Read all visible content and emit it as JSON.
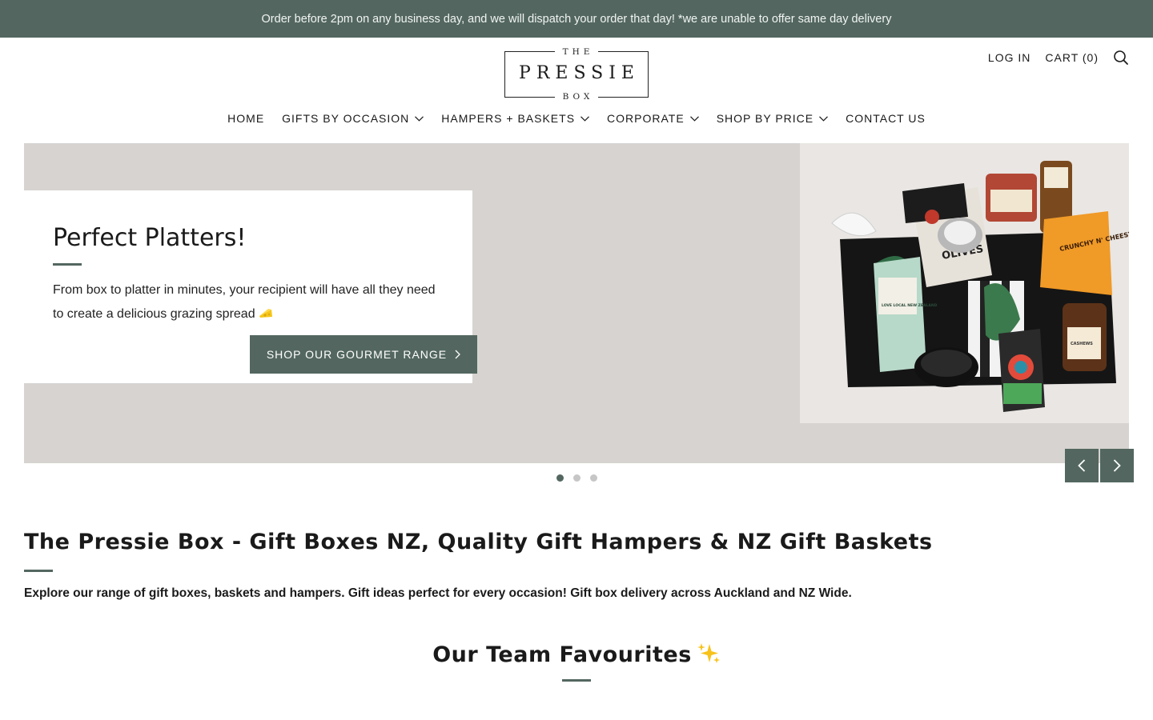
{
  "announcement": "Order before 2pm on any business day, and we will dispatch your order that day! *we are unable to offer same day delivery",
  "logo": {
    "top": "THE",
    "main": "PRESSIE",
    "bottom": "BOX"
  },
  "header": {
    "login": "LOG IN",
    "cart": "CART (0)",
    "search_icon": "search-icon"
  },
  "nav": {
    "items": [
      {
        "label": "HOME",
        "has_dropdown": false
      },
      {
        "label": "GIFTS BY OCCASION",
        "has_dropdown": true
      },
      {
        "label": "HAMPERS + BASKETS",
        "has_dropdown": true
      },
      {
        "label": "CORPORATE",
        "has_dropdown": true
      },
      {
        "label": "SHOP BY PRICE",
        "has_dropdown": true
      },
      {
        "label": "CONTACT US",
        "has_dropdown": false
      }
    ]
  },
  "hero": {
    "title": "Perfect Platters!",
    "text": "From box to platter in minutes, your recipient will have all they need to create a delicious grazing spread",
    "button": "SHOP OUR GOURMET RANGE",
    "slides": 3,
    "active_slide": 1,
    "image_labels": [
      "OLIVES",
      "LOVE LOCAL NEW ZEALAND",
      "CRUNCHY N' CHEESY",
      "CASHEWS"
    ]
  },
  "main": {
    "title": "The Pressie Box - Gift Boxes NZ, Quality Gift Hampers & NZ Gift Baskets",
    "intro": "Explore our range of gift boxes, baskets and hampers. Gift ideas perfect for every occasion! Gift box delivery across Auckland and NZ Wide."
  },
  "favourites": {
    "title": "Our Team Favourites"
  },
  "colors": {
    "brand": "#536760",
    "hero_bg": "#d6d3d0",
    "text": "#1a1a1a"
  }
}
